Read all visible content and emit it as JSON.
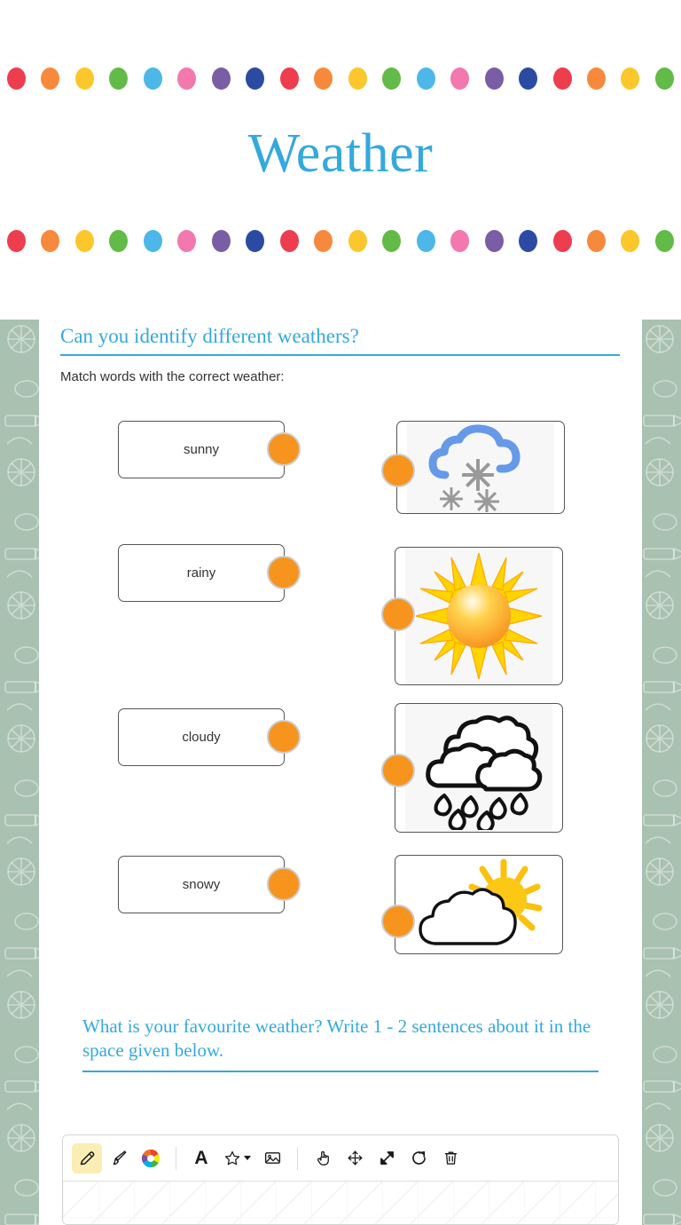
{
  "header": {
    "title": "Weather",
    "title_color": "#34a9dc",
    "dot_colors": [
      "#ee3d4f",
      "#f7893c",
      "#fcc72c",
      "#62bb46",
      "#4cb7e8",
      "#f278ad",
      "#7a5ea5",
      "#2b4ba3"
    ],
    "dot_count_per_row": 20
  },
  "worksheet": {
    "background_color": "#a9c1b0",
    "accent_color": "#34a9dc",
    "knob_color": "#f7941e",
    "question1": {
      "heading": "Can you identify different weathers?",
      "instruction": "Match words with the correct weather:",
      "words": [
        {
          "label": "sunny"
        },
        {
          "label": "rainy"
        },
        {
          "label": "cloudy"
        },
        {
          "label": "snowy"
        }
      ],
      "images": [
        {
          "alt": "snowy-cloud-image"
        },
        {
          "alt": "sun-image"
        },
        {
          "alt": "rain-cloud-image"
        },
        {
          "alt": "partly-cloudy-image"
        }
      ]
    },
    "question2": {
      "prompt": "What is your favourite weather? Write 1 - 2 sentences about it in the space given below."
    }
  },
  "drawing_tool": {
    "tools": [
      {
        "name": "pencil-tool",
        "active": true
      },
      {
        "name": "brush-tool",
        "active": false
      },
      {
        "name": "color-picker-tool",
        "active": false
      },
      {
        "name": "text-tool",
        "label": "A",
        "active": false
      },
      {
        "name": "shape-tool",
        "active": false
      },
      {
        "name": "image-tool",
        "active": false
      },
      {
        "name": "hand-tool",
        "active": false
      },
      {
        "name": "move-tool",
        "active": false
      },
      {
        "name": "resize-tool",
        "active": false
      },
      {
        "name": "redo-tool",
        "active": false
      },
      {
        "name": "delete-tool",
        "active": false
      }
    ]
  }
}
